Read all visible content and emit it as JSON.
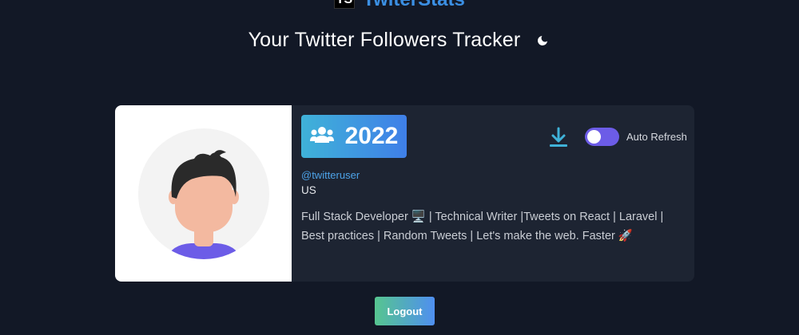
{
  "brand": {
    "logo_text": "TS",
    "name": "TwiterStats"
  },
  "header": {
    "title": "Your Twitter Followers Tracker",
    "theme_icon": "moon-icon"
  },
  "profile": {
    "avatar_icon": "user-avatar-illustration",
    "year": "2022",
    "year_icon": "users-group-icon",
    "download_icon": "download-icon",
    "auto_refresh": {
      "label": "Auto Refresh",
      "enabled": false
    },
    "handle": "@twitteruser",
    "location": "US",
    "bio": "Full Stack Developer 🖥️ | Technical Writer |Tweets on React | Laravel | Best practices | Random Tweets | Let's make the web. Faster 🚀"
  },
  "actions": {
    "logout_label": "Logout"
  },
  "colors": {
    "background": "#121826",
    "card": "#1d2432",
    "accent_blue": "#3b8fe3",
    "toggle_purple": "#6c5ce7",
    "link": "#4da3e8"
  }
}
